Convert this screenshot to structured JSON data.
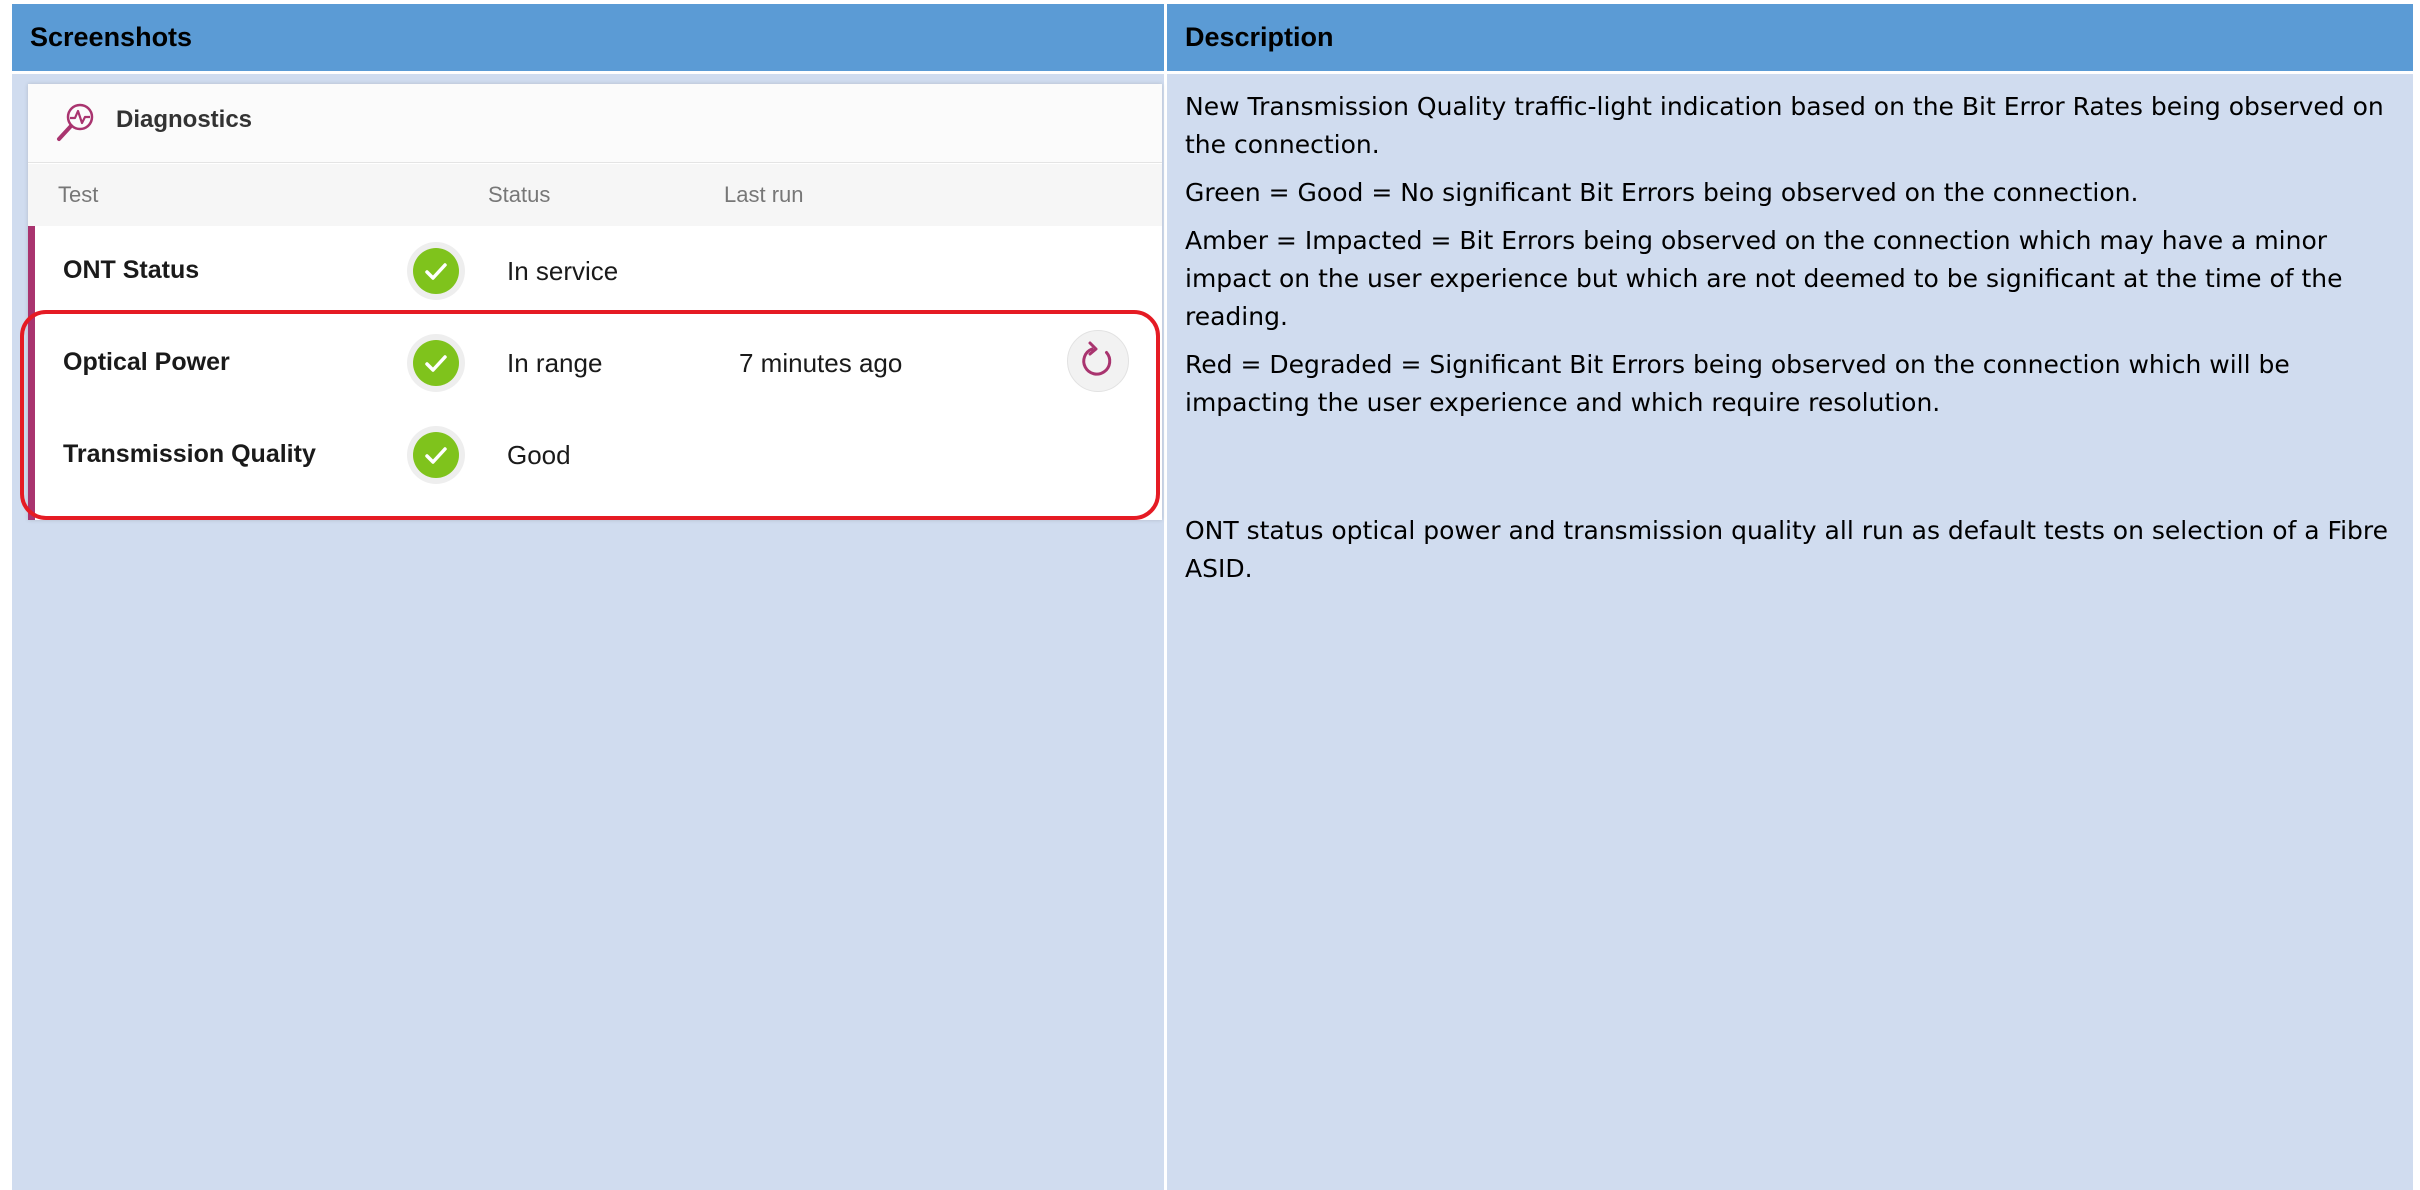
{
  "table": {
    "headers": {
      "left": "Screenshots",
      "right": "Description"
    }
  },
  "diagnostics": {
    "title": "Diagnostics",
    "icon": "diagnostics-magnifier-icon",
    "columns": {
      "test": "Test",
      "status": "Status",
      "last_run": "Last run"
    },
    "rows": [
      {
        "test": "ONT Status",
        "status": "In service",
        "last_run": "",
        "status_icon": "check-icon"
      },
      {
        "test": "Optical Power",
        "status": "In range",
        "last_run": "7 minutes ago",
        "status_icon": "check-icon"
      },
      {
        "test": "Transmission Quality",
        "status": "Good",
        "last_run": "",
        "status_icon": "check-icon"
      }
    ],
    "refresh_icon": "refresh-icon",
    "colors": {
      "check_green": "#7fc31c",
      "accent_bar": "#a9346f",
      "refresh_icon": "#a9346f",
      "highlight": "#e51b24"
    }
  },
  "description": {
    "paragraphs": [
      "New Transmission Quality traffic-light indication based on the Bit Error Rates being observed on the connection.",
      "Green = Good = No significant Bit Errors being observed on the connection.",
      "Amber = Impacted = Bit Errors being observed on the connection which may have a minor impact on the user experience but which are not deemed to be significant at the time of the reading.",
      "Red = Degraded = Significant Bit Errors being observed on the connection which will  be impacting the user experience and which require resolution.",
      "ONT status optical power and transmission quality all run as default tests on selection of a Fibre ASID."
    ]
  },
  "colors": {
    "header_bg": "#5b9bd5",
    "cell_bg": "#d0dcef"
  }
}
